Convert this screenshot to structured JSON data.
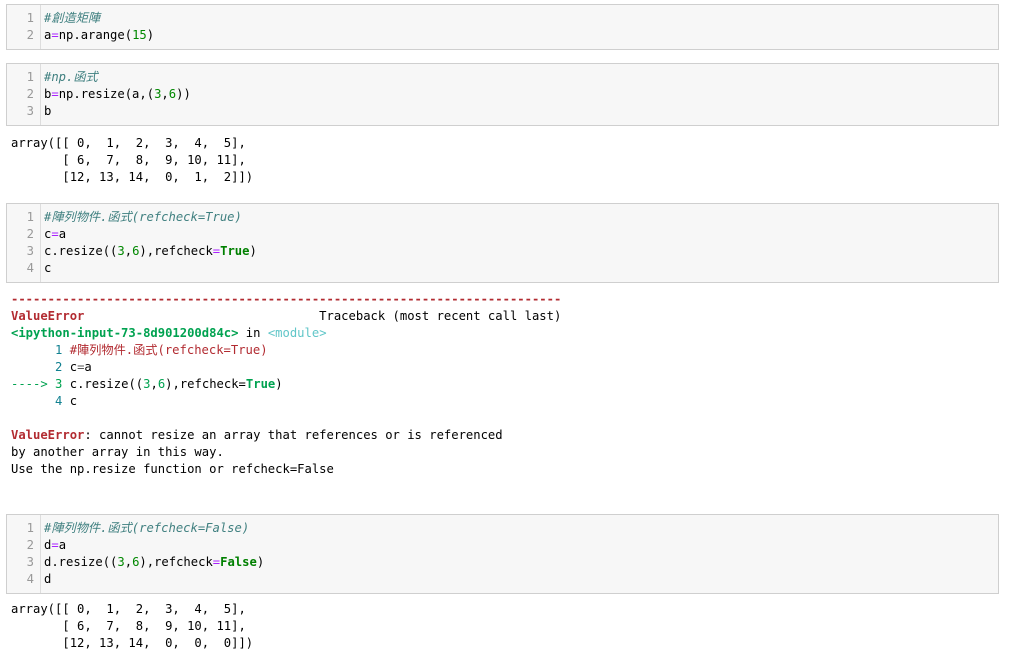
{
  "cells": [
    {
      "lines": [
        [
          {
            "t": "#創造矩陣",
            "c": "cm"
          }
        ],
        [
          {
            "t": "a"
          },
          {
            "t": "=",
            "c": "op"
          },
          {
            "t": "np.arange("
          },
          {
            "t": "15",
            "c": "num"
          },
          {
            "t": ")"
          }
        ]
      ]
    },
    {
      "lines": [
        [
          {
            "t": "#np.函式",
            "c": "cm"
          }
        ],
        [
          {
            "t": "b"
          },
          {
            "t": "=",
            "c": "op"
          },
          {
            "t": "np.resize(a,("
          },
          {
            "t": "3",
            "c": "num"
          },
          {
            "t": ","
          },
          {
            "t": "6",
            "c": "num"
          },
          {
            "t": "))"
          }
        ],
        [
          {
            "t": "b"
          }
        ]
      ],
      "output": [
        "array([[ 0,  1,  2,  3,  4,  5],",
        "       [ 6,  7,  8,  9, 10, 11],",
        "       [12, 13, 14,  0,  1,  2]])"
      ]
    },
    {
      "lines": [
        [
          {
            "t": "#陣列物件.函式(refcheck=True)",
            "c": "cm"
          }
        ],
        [
          {
            "t": "c"
          },
          {
            "t": "=",
            "c": "op"
          },
          {
            "t": "a"
          }
        ],
        [
          {
            "t": "c.resize(("
          },
          {
            "t": "3",
            "c": "num"
          },
          {
            "t": ","
          },
          {
            "t": "6",
            "c": "num"
          },
          {
            "t": "),refcheck"
          },
          {
            "t": "=",
            "c": "op"
          },
          {
            "t": "True",
            "c": "kw"
          },
          {
            "t": ")"
          }
        ],
        [
          {
            "t": "c"
          }
        ]
      ],
      "traceback": [
        [
          {
            "t": "---------------------------------------------------------------------------",
            "c": "tb-red"
          }
        ],
        [
          {
            "t": "ValueError",
            "c": "tb-red"
          },
          {
            "t": "                                Traceback (most recent call last)"
          }
        ],
        [
          {
            "t": "<ipython-input-73-8d901200d84c>",
            "c": "tb-green"
          },
          {
            "t": " in "
          },
          {
            "t": "<module>",
            "c": "tb-cyan"
          }
        ],
        [
          {
            "t": "      "
          },
          {
            "t": "1",
            "c": "tb-ln"
          },
          {
            "t": " #陣列物件.函式(refcheck=True)",
            "c": "tb-cm"
          }
        ],
        [
          {
            "t": "      "
          },
          {
            "t": "2",
            "c": "tb-ln"
          },
          {
            "t": " c"
          },
          {
            "t": "=",
            "c": "tb-paren"
          },
          {
            "t": "a"
          }
        ],
        [
          {
            "t": "----> 3",
            "c": "tb-arrow"
          },
          {
            "t": " c"
          },
          {
            "t": "."
          },
          {
            "t": "resize"
          },
          {
            "t": "(("
          },
          {
            "t": "3",
            "c": "tb-num"
          },
          {
            "t": ","
          },
          {
            "t": "6",
            "c": "tb-num"
          },
          {
            "t": "),"
          },
          {
            "t": "refcheck"
          },
          {
            "t": "="
          },
          {
            "t": "True",
            "c": "tb-kw"
          },
          {
            "t": ")"
          }
        ],
        [
          {
            "t": "      "
          },
          {
            "t": "4",
            "c": "tb-ln"
          },
          {
            "t": " c"
          }
        ],
        [
          {
            "t": ""
          }
        ],
        [
          {
            "t": "ValueError",
            "c": "tb-red"
          },
          {
            "t": ": cannot resize an array that references or is referenced"
          }
        ],
        [
          {
            "t": "by another array in this way."
          }
        ],
        [
          {
            "t": "Use the np.resize function or refcheck=False"
          }
        ]
      ]
    },
    {
      "lines": [
        [
          {
            "t": "#陣列物件.函式(refcheck=False)",
            "c": "cm"
          }
        ],
        [
          {
            "t": "d"
          },
          {
            "t": "=",
            "c": "op"
          },
          {
            "t": "a"
          }
        ],
        [
          {
            "t": "d.resize(("
          },
          {
            "t": "3",
            "c": "num"
          },
          {
            "t": ","
          },
          {
            "t": "6",
            "c": "num"
          },
          {
            "t": "),refcheck"
          },
          {
            "t": "=",
            "c": "op"
          },
          {
            "t": "False",
            "c": "kw"
          },
          {
            "t": ")"
          }
        ],
        [
          {
            "t": "d"
          }
        ]
      ],
      "output": [
        "array([[ 0,  1,  2,  3,  4,  5],",
        "       [ 6,  7,  8,  9, 10, 11],",
        "       [12, 13, 14,  0,  0,  0]])"
      ]
    }
  ]
}
